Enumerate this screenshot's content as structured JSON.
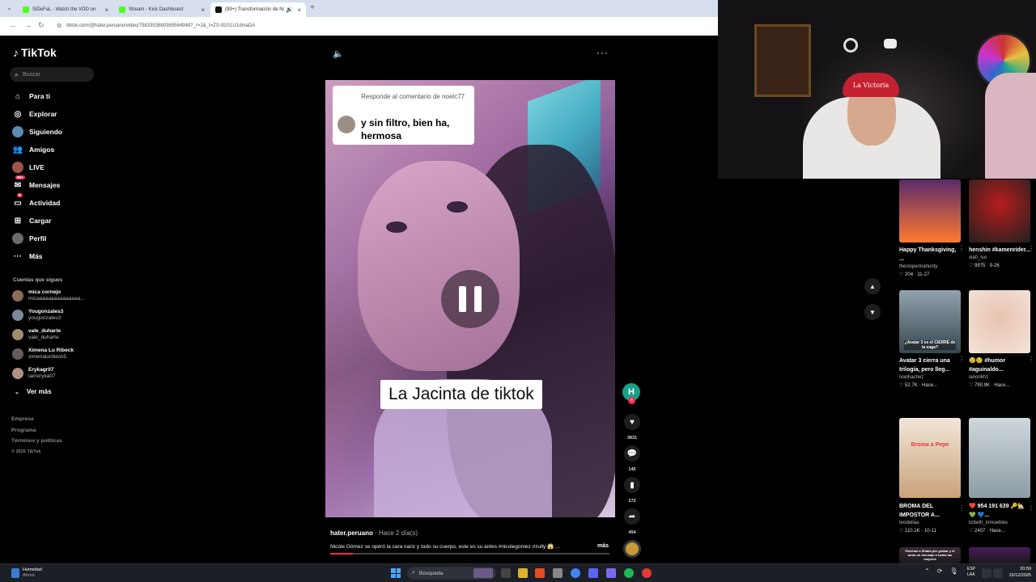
{
  "browser": {
    "tabs": [
      {
        "label": "SiDeFaL - Watch the VOD on",
        "color": "#53fc18"
      },
      {
        "label": "Stream - Kick Dashboard",
        "color": "#53fc18"
      },
      {
        "label": "(99+) Transformación de Ni",
        "color": "#111111"
      }
    ],
    "url": "tiktok.com/@hater.peruano/video/7583353880369564948?_r=1&_t=ZS-92G1U1dmaDA"
  },
  "sidebar": {
    "logo": "TikTok",
    "search_placeholder": "Buscar",
    "nav": [
      {
        "label": "Para ti",
        "icon": "home-icon"
      },
      {
        "label": "Explorar",
        "icon": "compass-icon"
      },
      {
        "label": "Siguiendo",
        "icon": "following-icon"
      },
      {
        "label": "Amigos",
        "icon": "friends-icon"
      },
      {
        "label": "LIVE",
        "icon": "live-icon"
      },
      {
        "label": "Mensajes",
        "icon": "messages-icon",
        "badge": "99+"
      },
      {
        "label": "Actividad",
        "icon": "activity-icon",
        "badge": "8"
      },
      {
        "label": "Cargar",
        "icon": "upload-icon"
      },
      {
        "label": "Perfil",
        "icon": "profile-icon"
      },
      {
        "label": "Más",
        "icon": "more-icon"
      }
    ],
    "following_title": "Cuentas que sigues",
    "following": [
      {
        "name": "mica cornejo",
        "handle": "micaaaaaaaaaaaaaaa..."
      },
      {
        "name": "Yougonzales3",
        "handle": "yougonzales3"
      },
      {
        "name": "vale_duharte",
        "handle": "vale_duharte"
      },
      {
        "name": "Ximena Lu Ribeck",
        "handle": "ximenaluribeck5"
      },
      {
        "name": "Erykagr07",
        "handle": "iameryka07"
      }
    ],
    "see_more": "Ver más",
    "footer": [
      "Empresa",
      "Programa",
      "Términos y políticas"
    ],
    "copyright": "© 2025 TikTok"
  },
  "video": {
    "comment_header": "Responde al comentario de noelc77",
    "comment_text": "y sin filtro, bien ha, hermosa",
    "caption": "La Jacinta de tiktok",
    "author": "hater.peruano",
    "age": " · Hace 2 día(s)",
    "description": "Nicole Gómez se operó la cara nariz y todo su cuerpo, este es su antes #nicolegomez #zully 😱 ...",
    "more_label": "más",
    "progress": 0.08
  },
  "actions": {
    "creator_initial": "H",
    "likes": "3831",
    "comments": "145",
    "saves": "272",
    "shares": "454"
  },
  "webcam": {
    "cap_text": "La Victoria"
  },
  "thumbnails": [
    {
      "title": "Happy Thanksgiving, ...",
      "author": "thesloperinahunty",
      "stats": "♡ 204 · 11-27",
      "color1": "#ff7a2f",
      "color2": "#6a1b9a"
    },
    {
      "title": "henshin #kamenrider...",
      "author": "xia0_luo",
      "stats": "♡ 9975 · 9-26",
      "color1": "#b71c1c",
      "color2": "#212121"
    },
    {
      "title": "Avatar 3 cierra una trilogía, pero lleg...",
      "author": "ivanhachez",
      "stats": "♡ 52.7K · Hace...",
      "color1": "#37474f",
      "color2": "#90a4ae",
      "overlay": "¿Avatar 3 es el CIERRE de la saga?"
    },
    {
      "title": "😢😢 #humor #aguinaldo...",
      "author": "ianorikh1",
      "stats": "♡ 790.9K · Hace...",
      "color1": "#e9c3b0",
      "color2": "#f3e3da"
    },
    {
      "title": "BROMA DEL IMPOSTOR A...",
      "author": "teodellaa",
      "stats": "♡ 110.1K · 10-11",
      "color1": "#f1e7d8",
      "color2": "#c9a27a",
      "overlay": "Broma a Pepe"
    },
    {
      "title": "❤️ 954 191 639 🔑🏡💚 💙...",
      "author": "lizbeth_inmuebles",
      "stats": "♡ 2407 · Hace...",
      "color1": "#cfd8dc",
      "color2": "#8d9ca3"
    },
    {
      "title": "",
      "author": "",
      "stats": "",
      "color1": "#3e2a3a",
      "color2": "#1a1a1a",
      "overlay": "Parchan a Shaka por grabar y él arma un mensaje a todas las mujeres"
    },
    {
      "title": "",
      "author": "",
      "stats": "",
      "color1": "#4a1a5a",
      "color2": "#1a1a1a"
    }
  ],
  "taskbar": {
    "weather_title": "Humedad",
    "weather_sub": "Ahora",
    "search": "Búsqueda",
    "lang1": "ESP",
    "lang2": "LAA",
    "time": "20:59",
    "date": "15/12/2025"
  }
}
